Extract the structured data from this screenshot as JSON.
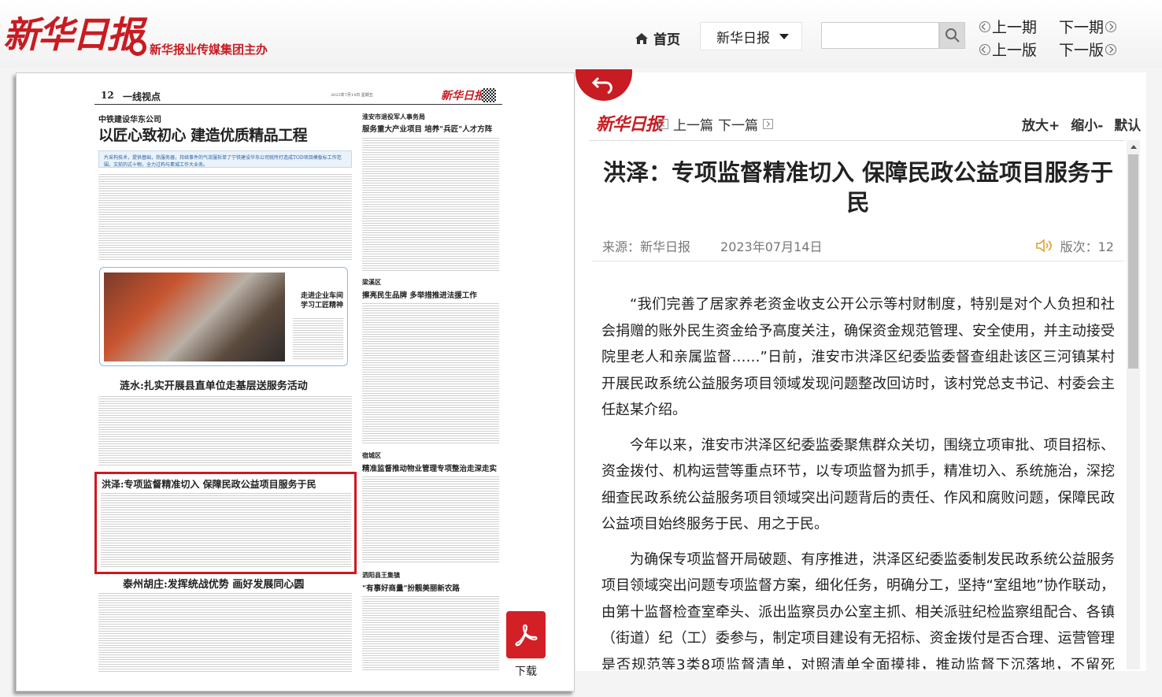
{
  "header": {
    "logo_text": "新华日报",
    "subtitle": "新华报业传媒集团主办",
    "home_label": "首页",
    "paper_select_value": "新华日报",
    "search_placeholder": "",
    "prev_issue": "上一期",
    "next_issue": "下一期",
    "prev_page": "上一版",
    "next_page": "下一版"
  },
  "newspaper_page": {
    "page_number": "12",
    "section": "一线视点",
    "date_line": "2023年7月14日 星期五",
    "masthead": "新华日报",
    "kicker1": "中铁建设华东公司",
    "headline1": "以匠心致初心  建造优质精品工程",
    "lead1": "片采构技术，提供基础，热服务器，持续事件的气流服拆单了宁铁建设华东公司就所打造成TOD项目模板标工作范围，文前的式十物，全力过构与素城工作大业务。",
    "photo_caption_line1": "走进企业车间",
    "photo_caption_line2": "学习工匠精神",
    "headline2": "涟水:扎实开展县直单位走基层送服务活动",
    "headline3": "洪泽:专项监督精准切入  保障民政公益项目服务于民",
    "headline4": "泰州胡庄:发挥统战优势  画好发展同心圆",
    "side1_kicker": "淮安市退役军人事务局",
    "side1_head": "服务重大产业项目  培养\"兵匠\"人才方阵",
    "side2_kicker": "梁溪区",
    "side2_head": "擦亮民生品牌  多举措推进法援工作",
    "side3_kicker": "宿城区",
    "side3_head": "精准监督推动物业管理专项整治走深走实",
    "side4_kicker": "泗阳县王集镇",
    "side4_head": "\"有事好商量\"扮靓美丽新农路"
  },
  "download_label": "下载",
  "article": {
    "mini_logo": "新华日报",
    "prev_article": "上一篇",
    "next_article": "下一篇",
    "zoom_in": "放大+",
    "zoom_out": "缩小-",
    "zoom_default": "默认",
    "title": "洪泽：专项监督精准切入 保障民政公益项目服务于民",
    "source": "来源：新华日报",
    "date": "2023年07月14日",
    "page_label": "版次：12",
    "paragraphs": [
      "“我们完善了居家养老资金收支公开公示等村财制度，特别是对个人负担和社会捐赠的账外民生资金给予高度关注，确保资金规范管理、安全使用，并主动接受院里老人和亲属监督……”日前，淮安市洪泽区纪委监委督查组赴该区三河镇某村开展民政系统公益服务项目领域发现问题整改回访时，该村党总支书记、村委会主任赵某介绍。",
      "今年以来，淮安市洪泽区纪委监委聚焦群众关切，围绕立项审批、项目招标、资金拨付、机构运营等重点环节，以专项监督为抓手，精准切入、系统施治，深挖细查民政系统公益服务项目领域突出问题背后的责任、作风和腐败问题，保障民政公益项目始终服务于民、用之于民。",
      "为确保专项监督开局破题、有序推进，洪泽区纪委监委制发民政系统公益服务项目领域突出问题专项监督方案，细化任务，明确分工，坚持“室组地”协作联动，由第十监督检查室牵头、派出监察员办公室主抓、相关派驻纪检监察组配合、各镇（街道）纪（工）委参与，制定项目建设有无招标、资金拨付是否合理、运营管理是否规范等3类8项监督清单，对照清单全面摸排，推动监督下沉落地，不留死角。"
    ]
  },
  "colors": {
    "brand_red": "#c71c22",
    "highlight_border": "#d0181e",
    "pdf_red": "#d31f26"
  },
  "icons": [
    "home-icon",
    "chevron-down-icon",
    "search-icon",
    "circle-left-icon",
    "circle-right-icon",
    "back-arrow-icon",
    "square-left-icon",
    "square-right-icon",
    "speaker-icon",
    "pdf-icon"
  ]
}
